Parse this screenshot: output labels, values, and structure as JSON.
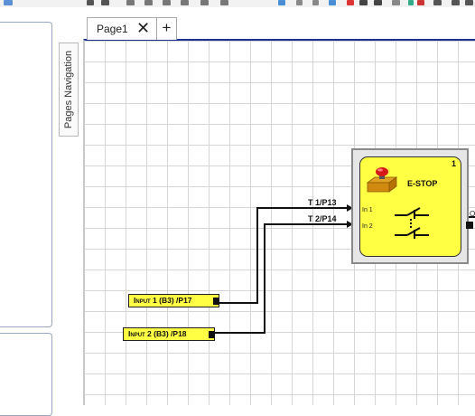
{
  "page_tabs": [
    {
      "label": "Page1",
      "close": "✕"
    }
  ],
  "add_tab": "+",
  "pages_navigation": {
    "label": "Pages Navigation"
  },
  "inputs": [
    {
      "label": "Input 1 (B3) /P17"
    },
    {
      "label": "Input 2 (B3) /P18"
    }
  ],
  "wires": [
    {
      "label": "T 1/P13"
    },
    {
      "label": "T 2/P14"
    }
  ],
  "estop": {
    "number": "1",
    "title": "E-STOP",
    "ports": [
      "In 1",
      "In 2"
    ],
    "output_label": "O"
  },
  "colors": {
    "block_yellow": "#ffff44",
    "canvas_border": "#1e2f96",
    "grid": "#d6d6d6"
  }
}
